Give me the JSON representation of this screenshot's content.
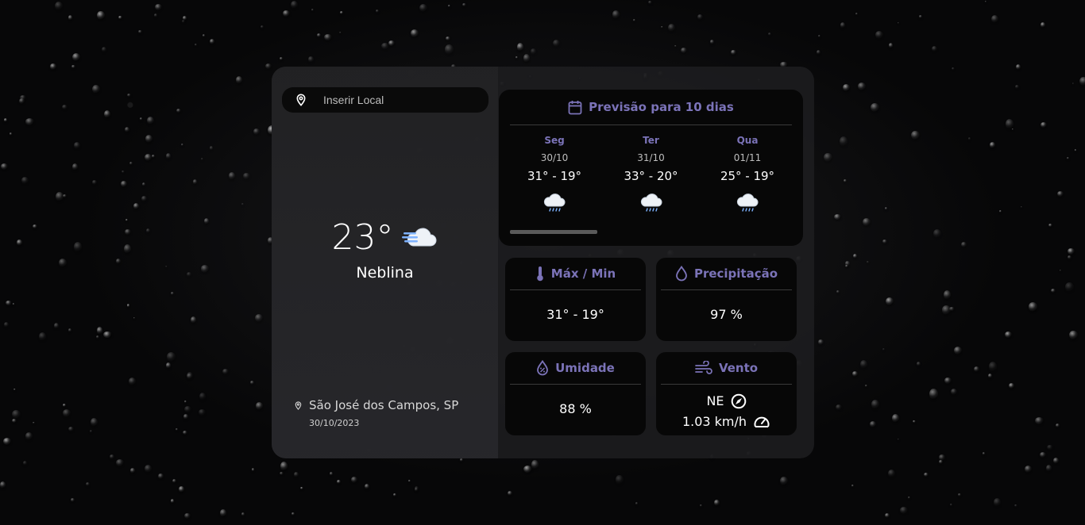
{
  "search": {
    "placeholder": "Inserir Local",
    "icon": "map-pin-icon"
  },
  "current": {
    "temperature": "23°",
    "condition": "Neblina",
    "condition_icon": "fog-cloud-icon",
    "location": "São José dos Campos, SP",
    "date": "30/10/2023"
  },
  "forecast": {
    "title": "Previsão para 10 dias",
    "icon": "calendar-icon",
    "days": [
      {
        "name": "Seg",
        "date": "30/10",
        "temps": "31° - 19°",
        "icon": "rain-cloud-icon"
      },
      {
        "name": "Ter",
        "date": "31/10",
        "temps": "33° - 20°",
        "icon": "rain-cloud-icon"
      },
      {
        "name": "Qua",
        "date": "01/11",
        "temps": "25° - 19°",
        "icon": "rain-cloud-icon"
      }
    ]
  },
  "tiles": {
    "maxmin": {
      "title": "Máx / Min",
      "value": "31° - 19°",
      "icon": "thermometer-icon"
    },
    "precip": {
      "title": "Precipitação",
      "value": "97 %",
      "icon": "droplet-icon"
    },
    "humidity": {
      "title": "Umidade",
      "value": "88 %",
      "icon": "humidity-icon"
    },
    "wind": {
      "title": "Vento",
      "direction": "NE",
      "speed": "1.03 km/h",
      "icon": "wind-icon"
    }
  },
  "colors": {
    "accent": "#7b73b8",
    "card": "#1c1c1e",
    "tile": "#070707"
  }
}
